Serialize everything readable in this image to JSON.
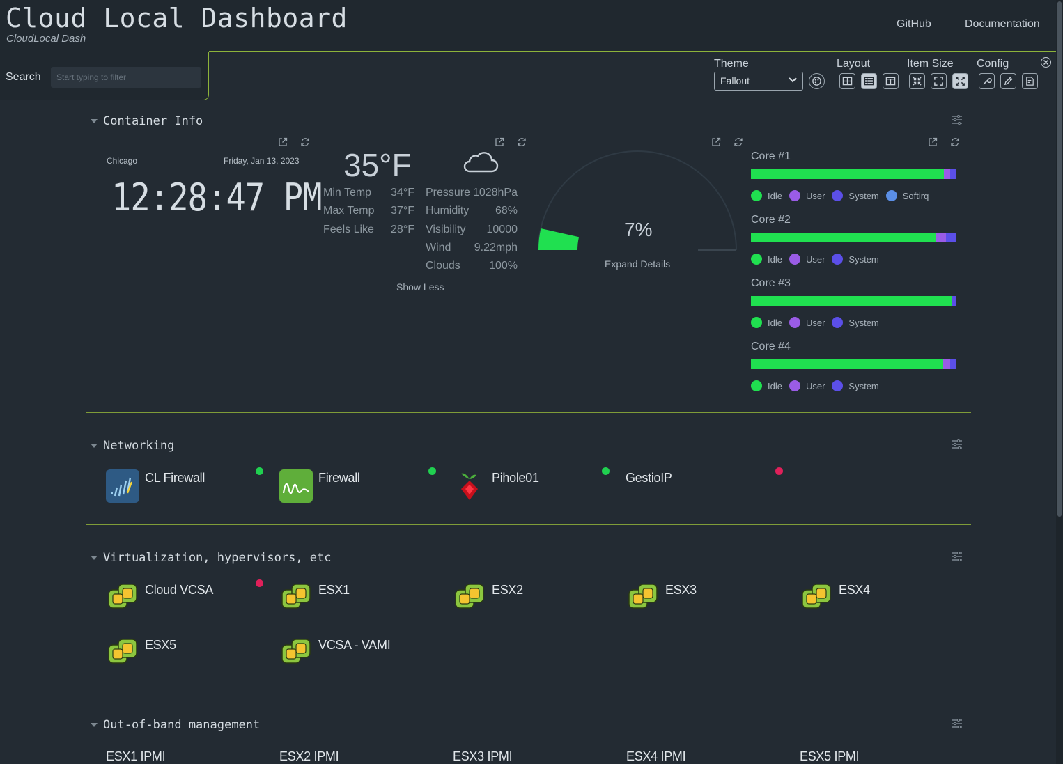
{
  "header": {
    "title": "Cloud Local Dashboard",
    "subtitle": "CloudLocal Dash",
    "nav": [
      "GitHub",
      "Documentation"
    ]
  },
  "search": {
    "label": "Search",
    "placeholder": "Start typing to filter"
  },
  "settings": {
    "theme_label": "Theme",
    "theme_value": "Fallout",
    "layout_label": "Layout",
    "item_size_label": "Item Size",
    "config_label": "Config",
    "active_layout": "auto",
    "active_item_size": "large"
  },
  "sections": {
    "container_info": {
      "title": "Container Info",
      "clock": {
        "city": "Chicago",
        "date": "Friday, Jan 13, 2023",
        "time": "12:28:47 PM"
      },
      "weather": {
        "temp": "35°F",
        "icon": "cloud-icon",
        "left": [
          {
            "label": "Min Temp",
            "value": "34°F"
          },
          {
            "label": "Max Temp",
            "value": "37°F"
          },
          {
            "label": "Feels Like",
            "value": "28°F"
          }
        ],
        "right": [
          {
            "label": "Pressure",
            "value": "1028hPa"
          },
          {
            "label": "Humidity",
            "value": "68%"
          },
          {
            "label": "Visibility",
            "value": "10000"
          },
          {
            "label": "Wind",
            "value": "9.22mph"
          },
          {
            "label": "Clouds",
            "value": "100%"
          }
        ],
        "toggle": "Show Less"
      },
      "gauge": {
        "value": "7%",
        "fraction": 0.07,
        "link": "Expand Details"
      },
      "cpu": {
        "cores": [
          {
            "name": "Core #1",
            "idle": 0.94,
            "user": 0.03,
            "system": 0.03,
            "legend": [
              "Idle",
              "User",
              "System",
              "Softirq"
            ]
          },
          {
            "name": "Core #2",
            "idle": 0.9,
            "user": 0.05,
            "system": 0.05,
            "legend": [
              "Idle",
              "User",
              "System"
            ]
          },
          {
            "name": "Core #3",
            "idle": 0.98,
            "user": 0.0,
            "system": 0.02,
            "legend": [
              "Idle",
              "User",
              "System"
            ]
          },
          {
            "name": "Core #4",
            "idle": 0.935,
            "user": 0.035,
            "system": 0.03,
            "legend": [
              "Idle",
              "User",
              "System"
            ]
          }
        ],
        "legend_colors": {
          "Idle": "#20e050",
          "User": "#9a5ce6",
          "System": "#5b4fe8",
          "Softirq": "#5b8fe6"
        }
      }
    },
    "networking": {
      "title": "Networking",
      "items": [
        {
          "label": "CL Firewall",
          "status": "online"
        },
        {
          "label": "Firewall",
          "status": "online"
        },
        {
          "label": "Pihole01",
          "status": "online"
        },
        {
          "label": "GestioIP",
          "status": "offline"
        }
      ]
    },
    "virtualization": {
      "title": "Virtualization, hypervisors, etc",
      "items": [
        {
          "label": "Cloud VCSA",
          "status": "offline"
        },
        {
          "label": "ESX1"
        },
        {
          "label": "ESX2"
        },
        {
          "label": "ESX3"
        },
        {
          "label": "ESX4"
        },
        {
          "label": "ESX5"
        },
        {
          "label": "VCSA - VAMI"
        }
      ]
    },
    "oob": {
      "title": "Out-of-band management",
      "items": [
        "ESX1 IPMI",
        "ESX2 IPMI",
        "ESX3 IPMI",
        "ESX4 IPMI",
        "ESX5 IPMI"
      ]
    }
  },
  "colors": {
    "accent": "#8db33a",
    "online": "#20d050",
    "offline": "#e0205a",
    "background": "#232b33"
  }
}
